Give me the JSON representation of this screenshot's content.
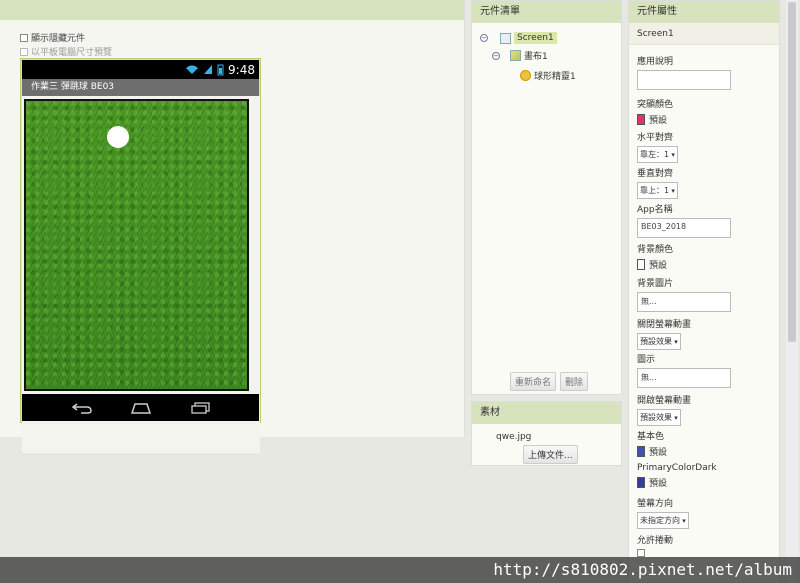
{
  "viewer": {
    "show_hidden_label": "顯示隱藏元件",
    "tablet_preview_label": "以平板電腦尺寸預覽",
    "status_time": "9:48",
    "app_title": "作業三 彈跳球 BE03"
  },
  "components": {
    "title": "元件清單",
    "tree": {
      "screen": "Screen1",
      "canvas": "畫布1",
      "sprite": "球形精靈1"
    },
    "rename_label": "重新命名",
    "delete_label": "刪除"
  },
  "media": {
    "title": "素材",
    "file": "qwe.jpg",
    "upload_label": "上傳文件..."
  },
  "properties": {
    "title": "元件屬性",
    "component": "Screen1",
    "about_label": "應用說明",
    "accent_label": "突顯顏色",
    "accent_value": "預設",
    "accent_color": "#e0336e",
    "halign_label": "水平對齊",
    "halign_value": "靠左：1",
    "valign_label": "垂直對齊",
    "valign_value": "靠上：1",
    "appname_label": "App名稱",
    "appname_value": "BE03_2018",
    "bgcolor_label": "背景顏色",
    "bgcolor_value": "預設",
    "bgimage_label": "背景圖片",
    "bgimage_value": "無...",
    "close_anim_label": "關閉螢幕動畫",
    "close_anim_value": "預設效果",
    "icon_label": "圖示",
    "icon_value": "無...",
    "open_anim_label": "開啟螢幕動畫",
    "open_anim_value": "預設效果",
    "primary_label": "基本色",
    "primary_value": "預設",
    "primary_color": "#3f51b5",
    "primary_dark_label": "PrimaryColorDark",
    "primary_dark_value": "預設",
    "primary_dark_color": "#303f9f",
    "orientation_label": "螢幕方向",
    "orientation_value": "未指定方向",
    "scroll_label": "允許捲動"
  },
  "watermark": "http://s810802.pixnet.net/album"
}
